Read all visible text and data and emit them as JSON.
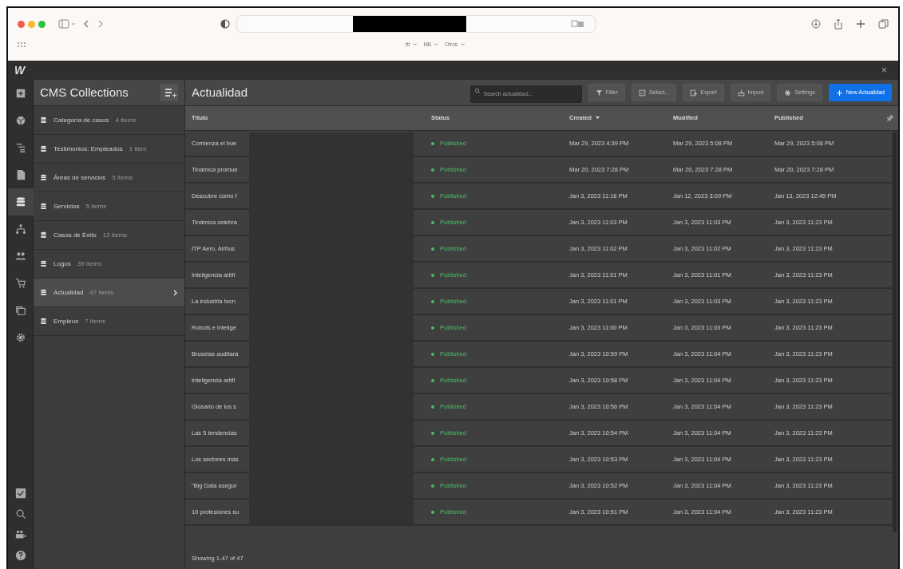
{
  "browser": {
    "bookmarks": [
      {
        "label": "ttt"
      },
      {
        "label": "MB"
      },
      {
        "label": "Otros"
      }
    ]
  },
  "app": {
    "logo": "W",
    "close": "×"
  },
  "rail": [
    {
      "selected": false
    },
    {
      "selected": false
    },
    {
      "selected": false
    },
    {
      "selected": false
    },
    {
      "selected": true
    },
    {
      "selected": false
    },
    {
      "selected": false
    },
    {
      "selected": false
    },
    {
      "selected": false
    },
    {
      "selected": false
    }
  ],
  "sidebar": {
    "title": "CMS Collections",
    "items": [
      {
        "name": "Categoría de casos",
        "count": "4 items",
        "selected": false
      },
      {
        "name": "Testimonios: Empleados",
        "count": "1 item",
        "selected": false
      },
      {
        "name": "Áreas de servicios",
        "count": "5 items",
        "selected": false
      },
      {
        "name": "Servicios",
        "count": "5 items",
        "selected": false
      },
      {
        "name": "Casos de Éxito",
        "count": "12 items",
        "selected": false
      },
      {
        "name": "Logos",
        "count": "39 items",
        "selected": false
      },
      {
        "name": "Actualidad",
        "count": "47 items",
        "selected": true
      },
      {
        "name": "Empleos",
        "count": "7 items",
        "selected": false
      }
    ]
  },
  "main": {
    "title": "Actualidad",
    "search": {
      "placeholder": "Search actualidad..."
    },
    "buttons": [
      {
        "label": "Filter",
        "kind": "plain"
      },
      {
        "label": "Select...",
        "kind": "plain"
      },
      {
        "label": "Export",
        "kind": "plain"
      },
      {
        "label": "Import",
        "kind": "plain"
      },
      {
        "label": "Settings",
        "kind": "plain"
      },
      {
        "label": "New Actualidad",
        "kind": "primary"
      }
    ],
    "table": {
      "columns": [
        {
          "label": "Título",
          "sorted": false
        },
        {
          "label": "Status",
          "sorted": false
        },
        {
          "label": "Created",
          "sorted": true
        },
        {
          "label": "Modified",
          "sorted": false
        },
        {
          "label": "Published",
          "sorted": false
        }
      ],
      "rows": [
        [
          "Comienza el bue",
          "Published",
          "Mar 29, 2023 4:39 PM",
          "Mar 29, 2023 5:08 PM",
          "Mar 29, 2023 5:08 PM"
        ],
        [
          "Tinámica promue",
          "Published",
          "Mar 20, 2023 7:28 PM",
          "Mar 20, 2023 7:28 PM",
          "Mar 20, 2023 7:28 PM"
        ],
        [
          "Descubre cómo f",
          "Published",
          "Jan 3, 2023 11:16 PM",
          "Jan 12, 2023 3:09 PM",
          "Jan 13, 2023 12:45 PM"
        ],
        [
          "Tinámica celebra",
          "Published",
          "Jan 3, 2023 11:03 PM",
          "Jan 3, 2023 11:03 PM",
          "Jan 3, 2023 11:23 PM"
        ],
        [
          "ITP Aero, Airbus",
          "Published",
          "Jan 3, 2023 11:02 PM",
          "Jan 3, 2023 11:02 PM",
          "Jan 3, 2023 11:23 PM"
        ],
        [
          "Inteligencia artifi",
          "Published",
          "Jan 3, 2023 11:01 PM",
          "Jan 3, 2023 11:01 PM",
          "Jan 3, 2023 11:23 PM"
        ],
        [
          "La industria tecn",
          "Published",
          "Jan 3, 2023 11:01 PM",
          "Jan 3, 2023 11:03 PM",
          "Jan 3, 2023 11:23 PM"
        ],
        [
          "Robots e intelige",
          "Published",
          "Jan 3, 2023 11:00 PM",
          "Jan 3, 2023 11:03 PM",
          "Jan 3, 2023 11:23 PM"
        ],
        [
          "Bruselas auditará",
          "Published",
          "Jan 3, 2023 10:59 PM",
          "Jan 3, 2023 11:04 PM",
          "Jan 3, 2023 11:23 PM"
        ],
        [
          "Inteligencia artifi",
          "Published",
          "Jan 3, 2023 10:58 PM",
          "Jan 3, 2023 11:04 PM",
          "Jan 3, 2023 11:23 PM"
        ],
        [
          "Glosario de los s",
          "Published",
          "Jan 3, 2023 10:56 PM",
          "Jan 3, 2023 11:04 PM",
          "Jan 3, 2023 11:23 PM"
        ],
        [
          "Las 5 tendencias",
          "Published",
          "Jan 3, 2023 10:54 PM",
          "Jan 3, 2023 11:04 PM",
          "Jan 3, 2023 11:23 PM"
        ],
        [
          "Los sectores más",
          "Published",
          "Jan 3, 2023 10:53 PM",
          "Jan 3, 2023 11:04 PM",
          "Jan 3, 2023 11:23 PM"
        ],
        [
          "\"Big Data asegur",
          "Published",
          "Jan 3, 2023 10:52 PM",
          "Jan 3, 2023 11:04 PM",
          "Jan 3, 2023 11:23 PM"
        ],
        [
          "10 profesiones su",
          "Published",
          "Jan 3, 2023 10:51 PM",
          "Jan 3, 2023 11:04 PM",
          "Jan 3, 2023 11:23 PM"
        ]
      ]
    },
    "footer": "Showing 1-47 of 47"
  }
}
